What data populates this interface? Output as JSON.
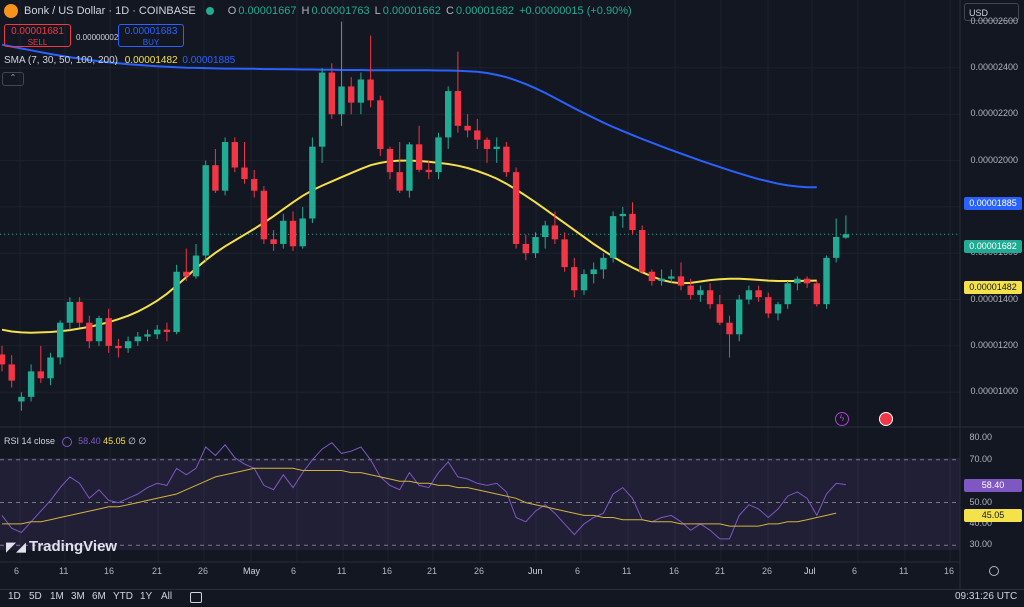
{
  "header": {
    "symbol_title": "Bonk / US Dollar · 1D · COINBASE",
    "open_key": "O",
    "open": "0.00001667",
    "high_key": "H",
    "high": "0.00001763",
    "low_key": "L",
    "low": "0.00001662",
    "close_key": "C",
    "close": "0.00001682",
    "change": "+0.00000015 (+0.90%)"
  },
  "trade": {
    "sell_price": "0.00001681",
    "sell_label": "SELL",
    "spread": "0.00000002",
    "buy_price": "0.00001683",
    "buy_label": "BUY"
  },
  "indicator": {
    "sma_label": "SMA (7, 30, 50, 100, 200)",
    "sma_v1": "0.00001482",
    "sma_v2": "0.00001885"
  },
  "rsi": {
    "label": "RSI 14 close",
    "value": "58.40",
    "ma_value": "45.05",
    "extra1": "∅",
    "extra2": "∅"
  },
  "currency": "USD",
  "price_axis": [
    "0.00002600",
    "0.00002400",
    "0.00002200",
    "0.00002000",
    "0.00001800",
    "0.00001600",
    "0.00001400",
    "0.00001200",
    "0.00001000"
  ],
  "price_markers": {
    "blue": "0.00001885",
    "green": "0.00001682",
    "yellow": "0.00001482"
  },
  "rsi_axis": [
    "80.00",
    "70.00",
    "50.00",
    "40.00",
    "30.00"
  ],
  "rsi_markers": {
    "rsi": "58.40",
    "ma": "45.05"
  },
  "x_axis": [
    "6",
    "11",
    "16",
    "21",
    "26",
    "May",
    "6",
    "11",
    "16",
    "21",
    "26",
    "Jun",
    "6",
    "11",
    "16",
    "21",
    "26",
    "Jul",
    "6",
    "11",
    "16"
  ],
  "timeframes": [
    "1D",
    "5D",
    "1M",
    "3M",
    "6M",
    "YTD",
    "1Y",
    "All"
  ],
  "clock": "09:31:26 UTC",
  "brand": "TradingView",
  "colors": {
    "up": "#22ab94",
    "down": "#f23645",
    "sma_slow": "#2962ff",
    "sma_fast": "#f5e14a",
    "rsi": "#7e57c2"
  },
  "chart_data": {
    "type": "candlestick",
    "title": "Bonk / US Dollar · 1D · COINBASE",
    "x_range": [
      "Apr 4",
      "Jul 5"
    ],
    "y_range": [
      8.8e-06,
      2.65e-05
    ],
    "candles_ohlc": [
      [
        1.163e-05,
        1.2e-05,
        1.09e-05,
        1.12e-05
      ],
      [
        1.12e-05,
        1.16e-05,
        1.02e-05,
        1.05e-05
      ],
      [
        9.6e-06,
        1e-05,
        9.2e-06,
        9.8e-06
      ],
      [
        9.8e-06,
        1.12e-05,
        9.6e-06,
        1.09e-05
      ],
      [
        1.09e-05,
        1.2e-05,
        1.04e-05,
        1.06e-05
      ],
      [
        1.06e-05,
        1.17e-05,
        1.03e-05,
        1.15e-05
      ],
      [
        1.15e-05,
        1.31e-05,
        1.12e-05,
        1.3e-05
      ],
      [
        1.3e-05,
        1.41e-05,
        1.27e-05,
        1.39e-05
      ],
      [
        1.39e-05,
        1.41e-05,
        1.28e-05,
        1.3e-05
      ],
      [
        1.3e-05,
        1.33e-05,
        1.19e-05,
        1.22e-05
      ],
      [
        1.22e-05,
        1.33e-05,
        1.2e-05,
        1.32e-05
      ],
      [
        1.32e-05,
        1.36e-05,
        1.17e-05,
        1.2e-05
      ],
      [
        1.2e-05,
        1.23e-05,
        1.15e-05,
        1.19e-05
      ],
      [
        1.19e-05,
        1.24e-05,
        1.17e-05,
        1.22e-05
      ],
      [
        1.22e-05,
        1.26e-05,
        1.2e-05,
        1.24e-05
      ],
      [
        1.24e-05,
        1.27e-05,
        1.22e-05,
        1.25e-05
      ],
      [
        1.25e-05,
        1.29e-05,
        1.23e-05,
        1.27e-05
      ],
      [
        1.27e-05,
        1.3e-05,
        1.22e-05,
        1.26e-05
      ],
      [
        1.26e-05,
        1.55e-05,
        1.25e-05,
        1.52e-05
      ],
      [
        1.52e-05,
        1.62e-05,
        1.48e-05,
        1.5e-05
      ],
      [
        1.5e-05,
        1.64e-05,
        1.49e-05,
        1.59e-05
      ],
      [
        1.59e-05,
        2e-05,
        1.56e-05,
        1.98e-05
      ],
      [
        1.98e-05,
        2.05e-05,
        1.86e-05,
        1.87e-05
      ],
      [
        1.87e-05,
        2.1e-05,
        1.85e-05,
        2.08e-05
      ],
      [
        2.08e-05,
        2.1e-05,
        1.95e-05,
        1.97e-05
      ],
      [
        1.97e-05,
        2.08e-05,
        1.9e-05,
        1.92e-05
      ],
      [
        1.92e-05,
        1.96e-05,
        1.84e-05,
        1.87e-05
      ],
      [
        1.87e-05,
        1.89e-05,
        1.64e-05,
        1.66e-05
      ],
      [
        1.66e-05,
        1.7e-05,
        1.61e-05,
        1.64e-05
      ],
      [
        1.64e-05,
        1.77e-05,
        1.62e-05,
        1.74e-05
      ],
      [
        1.74e-05,
        1.78e-05,
        1.61e-05,
        1.63e-05
      ],
      [
        1.63e-05,
        1.8e-05,
        1.62e-05,
        1.75e-05
      ],
      [
        1.75e-05,
        2.1e-05,
        1.73e-05,
        2.06e-05
      ],
      [
        2.06e-05,
        2.4e-05,
        1.99e-05,
        2.38e-05
      ],
      [
        2.38e-05,
        2.42e-05,
        2.18e-05,
        2.2e-05
      ],
      [
        2.2e-05,
        2.6e-05,
        2.15e-05,
        2.32e-05
      ],
      [
        2.32e-05,
        2.36e-05,
        2.2e-05,
        2.25e-05
      ],
      [
        2.25e-05,
        2.38e-05,
        2.2e-05,
        2.35e-05
      ],
      [
        2.35e-05,
        2.54e-05,
        2.23e-05,
        2.26e-05
      ],
      [
        2.26e-05,
        2.28e-05,
        2.02e-05,
        2.05e-05
      ],
      [
        2.05e-05,
        2.06e-05,
        1.92e-05,
        1.95e-05
      ],
      [
        1.95e-05,
        2.08e-05,
        1.86e-05,
        1.87e-05
      ],
      [
        1.87e-05,
        2.08e-05,
        1.84e-05,
        2.07e-05
      ],
      [
        2.07e-05,
        2.15e-05,
        1.95e-05,
        1.96e-05
      ],
      [
        1.96e-05,
        2e-05,
        1.92e-05,
        1.95e-05
      ],
      [
        1.95e-05,
        2.12e-05,
        1.92e-05,
        2.1e-05
      ],
      [
        2.1e-05,
        2.32e-05,
        2.05e-05,
        2.3e-05
      ],
      [
        2.3e-05,
        2.47e-05,
        2.12e-05,
        2.15e-05
      ],
      [
        2.15e-05,
        2.2e-05,
        2.1e-05,
        2.13e-05
      ],
      [
        2.13e-05,
        2.18e-05,
        2.05e-05,
        2.09e-05
      ],
      [
        2.09e-05,
        2.1e-05,
        1.99e-05,
        2.05e-05
      ],
      [
        2.05e-05,
        2.1e-05,
        1.99e-05,
        2.06e-05
      ],
      [
        2.06e-05,
        2.08e-05,
        1.93e-05,
        1.95e-05
      ],
      [
        1.95e-05,
        1.97e-05,
        1.62e-05,
        1.64e-05
      ],
      [
        1.64e-05,
        1.68e-05,
        1.57e-05,
        1.6e-05
      ],
      [
        1.6e-05,
        1.69e-05,
        1.58e-05,
        1.67e-05
      ],
      [
        1.67e-05,
        1.74e-05,
        1.62e-05,
        1.72e-05
      ],
      [
        1.72e-05,
        1.78e-05,
        1.64e-05,
        1.66e-05
      ],
      [
        1.66e-05,
        1.69e-05,
        1.52e-05,
        1.54e-05
      ],
      [
        1.54e-05,
        1.58e-05,
        1.41e-05,
        1.44e-05
      ],
      [
        1.44e-05,
        1.53e-05,
        1.42e-05,
        1.51e-05
      ],
      [
        1.51e-05,
        1.56e-05,
        1.47e-05,
        1.53e-05
      ],
      [
        1.53e-05,
        1.6e-05,
        1.49e-05,
        1.58e-05
      ],
      [
        1.58e-05,
        1.78e-05,
        1.56e-05,
        1.76e-05
      ],
      [
        1.76e-05,
        1.8e-05,
        1.71e-05,
        1.77e-05
      ],
      [
        1.77e-05,
        1.82e-05,
        1.68e-05,
        1.7e-05
      ],
      [
        1.7e-05,
        1.72e-05,
        1.51e-05,
        1.52e-05
      ],
      [
        1.52e-05,
        1.53e-05,
        1.46e-05,
        1.48e-05
      ],
      [
        1.48e-05,
        1.53e-05,
        1.46e-05,
        1.49e-05
      ],
      [
        1.49e-05,
        1.53e-05,
        1.47e-05,
        1.5e-05
      ],
      [
        1.5e-05,
        1.56e-05,
        1.44e-05,
        1.46e-05
      ],
      [
        1.46e-05,
        1.49e-05,
        1.4e-05,
        1.42e-05
      ],
      [
        1.42e-05,
        1.46e-05,
        1.39e-05,
        1.44e-05
      ],
      [
        1.44e-05,
        1.47e-05,
        1.36e-05,
        1.38e-05
      ],
      [
        1.38e-05,
        1.42e-05,
        1.29e-05,
        1.3e-05
      ],
      [
        1.3e-05,
        1.33e-05,
        1.15e-05,
        1.25e-05
      ],
      [
        1.25e-05,
        1.42e-05,
        1.22e-05,
        1.4e-05
      ],
      [
        1.4e-05,
        1.46e-05,
        1.38e-05,
        1.44e-05
      ],
      [
        1.44e-05,
        1.46e-05,
        1.39e-05,
        1.41e-05
      ],
      [
        1.41e-05,
        1.43e-05,
        1.32e-05,
        1.34e-05
      ],
      [
        1.34e-05,
        1.39e-05,
        1.31e-05,
        1.38e-05
      ],
      [
        1.38e-05,
        1.48e-05,
        1.36e-05,
        1.47e-05
      ],
      [
        1.47e-05,
        1.5e-05,
        1.44e-05,
        1.49e-05
      ],
      [
        1.49e-05,
        1.5e-05,
        1.45e-05,
        1.47e-05
      ],
      [
        1.47e-05,
        1.48e-05,
        1.37e-05,
        1.38e-05
      ],
      [
        1.38e-05,
        1.59e-05,
        1.36e-05,
        1.58e-05
      ],
      [
        1.58e-05,
        1.75e-05,
        1.56e-05,
        1.67e-05
      ],
      [
        1.667e-05,
        1.763e-05,
        1.662e-05,
        1.682e-05
      ]
    ],
    "sma_fast": [
      1.27e-05,
      1.262e-05,
      1.258e-05,
      1.257e-05,
      1.258e-05,
      1.26e-05,
      1.263e-05,
      1.268e-05,
      1.275e-05,
      1.282e-05,
      1.292e-05,
      1.302e-05,
      1.315e-05,
      1.33e-05,
      1.348e-05,
      1.37e-05,
      1.395e-05,
      1.425e-05,
      1.46e-05,
      1.497e-05,
      1.535e-05,
      1.57e-05,
      1.602e-05,
      1.63e-05,
      1.655e-05,
      1.68e-05,
      1.705e-05,
      1.732e-05,
      1.76e-05,
      1.79e-05,
      1.82e-05,
      1.848e-05,
      1.872e-05,
      1.892e-05,
      1.91e-05,
      1.928e-05,
      1.946e-05,
      1.964e-05,
      1.98e-05,
      1.99e-05,
      1.997e-05,
      2e-05,
      2e-05,
      1.998e-05,
      1.995e-05,
      1.99e-05,
      1.985e-05,
      1.978e-05,
      1.968e-05,
      1.955e-05,
      1.94e-05,
      1.922e-05,
      1.9e-05,
      1.875e-05,
      1.848e-05,
      1.82e-05,
      1.79e-05,
      1.76e-05,
      1.73e-05,
      1.7e-05,
      1.67e-05,
      1.64e-05,
      1.612e-05,
      1.585e-05,
      1.56e-05,
      1.538e-05,
      1.518e-05,
      1.5e-05,
      1.485e-05,
      1.475e-05,
      1.47e-05,
      1.472e-05,
      1.478e-05,
      1.484e-05,
      1.488e-05,
      1.49e-05,
      1.49e-05,
      1.488e-05,
      1.485e-05,
      1.482e-05,
      1.48e-05,
      1.48e-05,
      1.48e-05,
      1.481e-05,
      1.482e-05
    ],
    "sma_slow": [
      2.5e-05,
      2.492e-05,
      2.484e-05,
      2.476e-05,
      2.468e-05,
      2.46e-05,
      2.453e-05,
      2.446e-05,
      2.44e-05,
      2.434e-05,
      2.429e-05,
      2.424e-05,
      2.42e-05,
      2.416e-05,
      2.413e-05,
      2.41e-05,
      2.407e-05,
      2.405e-05,
      2.403e-05,
      2.401e-05,
      2.4e-05,
      2.399e-05,
      2.398e-05,
      2.397e-05,
      2.397e-05,
      2.396e-05,
      2.396e-05,
      2.395e-05,
      2.395e-05,
      2.394e-05,
      2.394e-05,
      2.393e-05,
      2.393e-05,
      2.392e-05,
      2.392e-05,
      2.391e-05,
      2.391e-05,
      2.391e-05,
      2.39e-05,
      2.39e-05,
      2.39e-05,
      2.39e-05,
      2.39e-05,
      2.39e-05,
      2.39e-05,
      2.389e-05,
      2.389e-05,
      2.388e-05,
      2.386e-05,
      2.383e-05,
      2.378e-05,
      2.37e-05,
      2.36e-05,
      2.346e-05,
      2.33e-05,
      2.312e-05,
      2.292e-05,
      2.27e-05,
      2.248e-05,
      2.226e-05,
      2.205e-05,
      2.184e-05,
      2.164e-05,
      2.145e-05,
      2.127e-05,
      2.11e-05,
      2.093e-05,
      2.077e-05,
      2.061e-05,
      2.045e-05,
      2.03e-05,
      2.015e-05,
      2e-05,
      1.986e-05,
      1.972e-05,
      1.958e-05,
      1.945e-05,
      1.932e-05,
      1.92e-05,
      1.91e-05,
      1.9e-05,
      1.893e-05,
      1.888e-05,
      1.885e-05,
      1.885e-05
    ],
    "rsi": [
      44,
      38,
      36,
      41,
      46,
      51,
      57,
      62,
      59,
      52,
      56,
      51,
      50,
      52,
      54,
      57,
      59,
      58,
      66,
      63,
      66,
      76,
      72,
      77,
      71,
      68,
      66,
      58,
      56,
      63,
      57,
      64,
      70,
      75,
      78,
      73,
      74,
      76,
      70,
      62,
      58,
      56,
      64,
      58,
      57,
      64,
      69,
      62,
      61,
      59,
      58,
      59,
      55,
      43,
      41,
      46,
      49,
      45,
      40,
      35,
      40,
      43,
      45,
      54,
      57,
      52,
      42,
      41,
      43,
      44,
      41,
      37,
      40,
      37,
      33,
      33,
      44,
      49,
      47,
      43,
      47,
      53,
      55,
      52,
      44,
      54,
      59,
      58.4
    ],
    "rsi_ma": [
      40,
      40,
      40,
      41,
      41,
      42,
      43,
      44,
      45,
      46,
      47,
      48,
      48,
      49,
      50,
      51,
      52,
      53,
      54,
      56,
      58,
      60,
      62,
      63,
      64,
      65,
      66,
      66,
      66,
      66,
      66,
      65,
      65,
      65,
      65,
      65,
      64,
      64,
      63,
      62,
      61,
      60,
      60,
      59,
      59,
      58,
      58,
      57,
      57,
      56,
      55,
      54,
      53,
      52,
      50,
      49,
      48,
      47,
      46,
      45,
      44,
      44,
      43,
      43,
      42,
      42,
      42,
      41,
      41,
      41,
      40,
      40,
      40,
      40,
      40,
      39,
      39,
      39,
      39,
      40,
      40,
      41,
      41,
      42,
      43,
      44,
      45.05
    ],
    "rsi_range": [
      25,
      83
    ],
    "rsi_levels": [
      70,
      50,
      30
    ]
  }
}
